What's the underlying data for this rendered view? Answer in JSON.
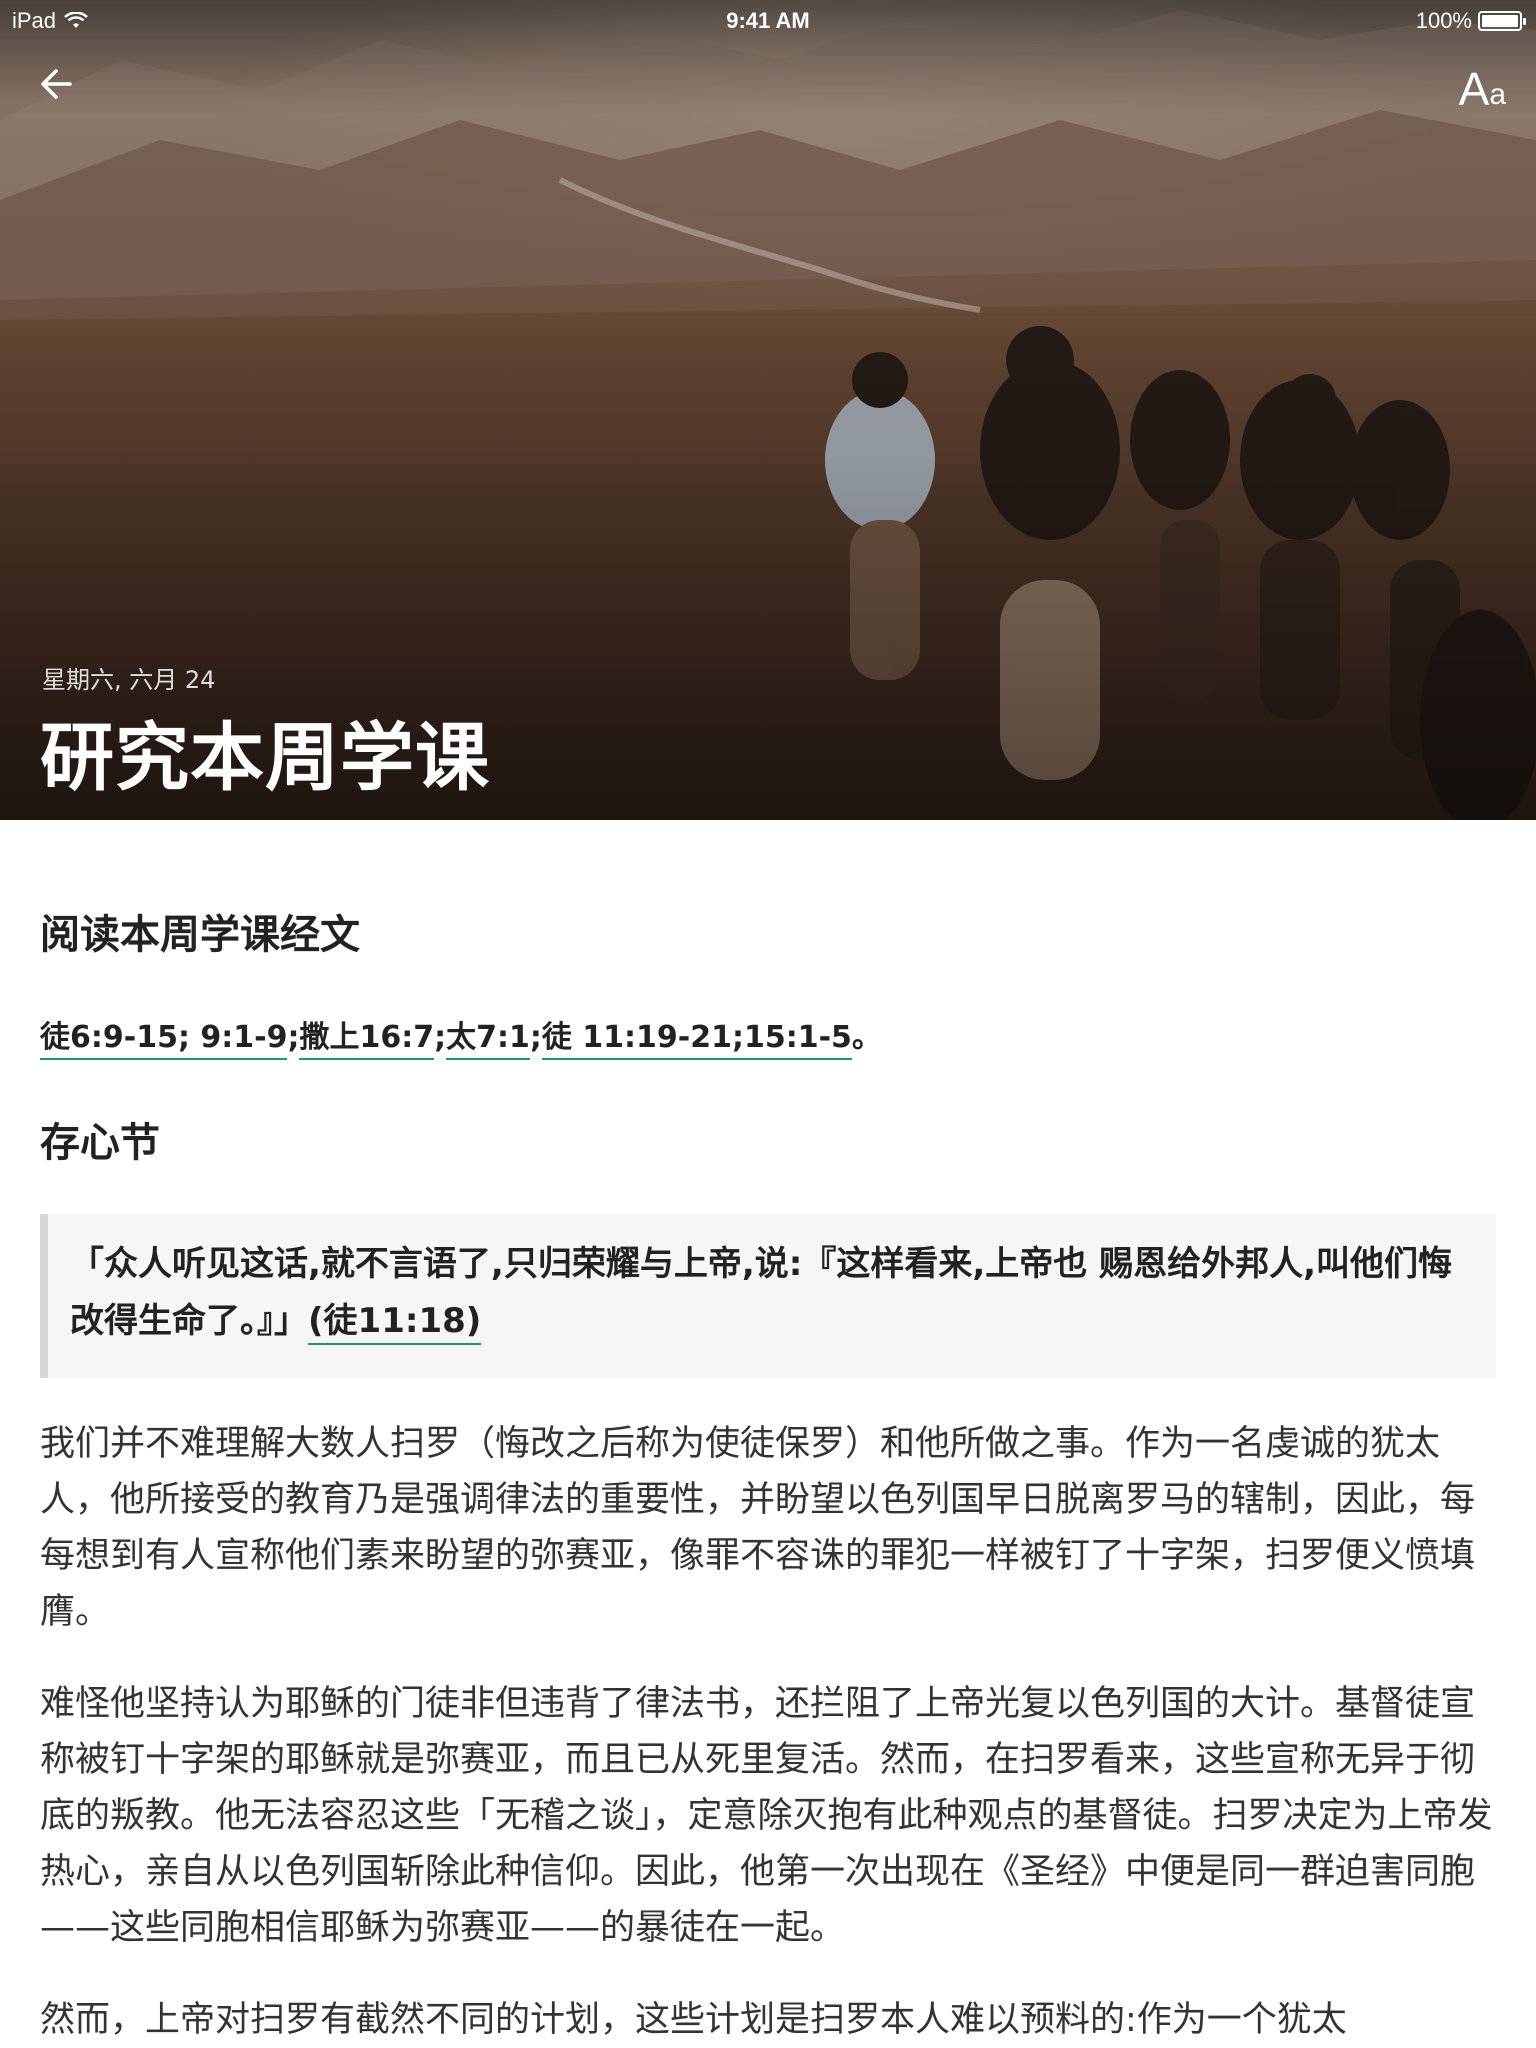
{
  "status_bar": {
    "device": "iPad",
    "time": "9:41 AM",
    "battery": "100%"
  },
  "header": {
    "back_icon": "arrow-left-icon",
    "font_settings_big": "A",
    "font_settings_small": "a",
    "date": "星期六, 六月 24",
    "title": "研究本周学课"
  },
  "sections": {
    "reading_heading": "阅读本周学课经文",
    "references": [
      "徒6:9-15; 9:1-9",
      "撒上16:7",
      "太7:1",
      "徒 11:19-21;15:1-5"
    ],
    "ref_separator": ";",
    "ref_end": "。",
    "memory_heading": "存心节",
    "memory_quote": "「众人听见这话,就不言语了,只归荣耀与上帝,说:『这样看来,上帝也 赐恩给外邦人,叫他们悔改得生命了。』」",
    "memory_ref": "(徒11:18)"
  },
  "body": {
    "paragraphs": [
      "我们并不难理解大数人扫罗（悔改之后称为使徒保罗）和他所做之事。作为一名虔诚的犹太人，他所接受的教育乃是强调律法的重要性，并盼望以色列国早日脱离罗马的辖制，因此，每每想到有人宣称他们素来盼望的弥赛亚，像罪不容诛的罪犯一样被钉了十字架，扫罗便义愤填膺。",
      "难怪他坚持认为耶稣的门徒非但违背了律法书，还拦阻了上帝光复以色列国的大计。基督徒宣称被钉十字架的耶稣就是弥赛亚，而且已从死里复活。然而，在扫罗看来，这些宣称无异于彻底的叛教。他无法容忍这些「无稽之谈」，定意除灭抱有此种观点的基督徒。扫罗决定为上帝发热心，亲自从以色列国斩除此种信仰。因此，他第一次出现在《圣经》中便是同一群迫害同胞——这些同胞相信耶稣为弥赛亚——的暴徒在一起。",
      "然而，上帝对扫罗有截然不同的计划，这些计划是扫罗本人难以预料的:作为一个犹太"
    ]
  },
  "colors": {
    "link_underline": "#1a9a68",
    "quote_background": "#f6f6f6",
    "quote_border": "#d6d6d6"
  }
}
